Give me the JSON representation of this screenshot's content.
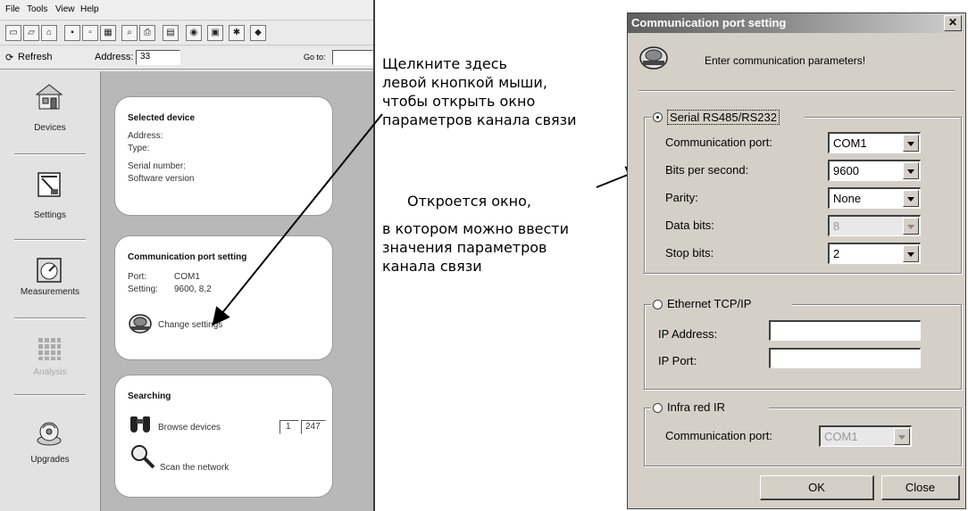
{
  "app": {
    "menu": [
      "File",
      "Tools",
      "View",
      "Help"
    ],
    "refresh_label": "Refresh",
    "address_label": "Address:",
    "address_value": "33",
    "goto_label": "Go to:"
  },
  "sidebar": {
    "items": [
      {
        "label": "Devices",
        "icon": "devices-icon"
      },
      {
        "label": "Settings",
        "icon": "settings-icon"
      },
      {
        "label": "Measurements",
        "icon": "measurements-icon"
      },
      {
        "label": "Analysis",
        "icon": "analysis-icon"
      },
      {
        "label": "Upgrades",
        "icon": "upgrades-icon"
      }
    ]
  },
  "cards": {
    "selected": {
      "title": "Selected device",
      "address": "Address:",
      "type": "Type:",
      "serial": "Serial number:",
      "software": "Software version"
    },
    "comm": {
      "title": "Communication port setting",
      "port_label": "Port:",
      "port_value": "COM1",
      "setting_label": "Setting:",
      "setting_value": "9600, 8,2",
      "change": "Change settings"
    },
    "search": {
      "title": "Searching",
      "browse": "Browse devices",
      "from": "1",
      "to": "247",
      "scan": "Scan the network"
    }
  },
  "annotations": {
    "top": [
      "Щелкните здесь",
      "левой кнопкой мыши,",
      "чтобы открыть окно",
      "параметров канала связи"
    ],
    "bottom": [
      "Откроется окно,",
      "в котором можно ввести",
      "значения параметров",
      "канала связи"
    ]
  },
  "dialog": {
    "title": "Communication port setting",
    "header": "Enter communication parameters!",
    "serial": {
      "label": "Serial RS485/RS232",
      "port_label": "Communication port:",
      "port_value": "COM1",
      "bps_label": "Bits per second:",
      "bps_value": "9600",
      "parity_label": "Parity:",
      "parity_value": "None",
      "databits_label": "Data bits:",
      "databits_value": "8",
      "stopbits_label": "Stop bits:",
      "stopbits_value": "2"
    },
    "ethernet": {
      "label": "Ethernet TCP/IP",
      "ip_label": "IP Address:",
      "port_label": "IP Port:",
      "ip_value": "",
      "port_value": ""
    },
    "ir": {
      "label": "Infra red IR",
      "port_label": "Communication port:",
      "port_value": "COM1"
    },
    "ok": "OK",
    "close": "Close"
  }
}
